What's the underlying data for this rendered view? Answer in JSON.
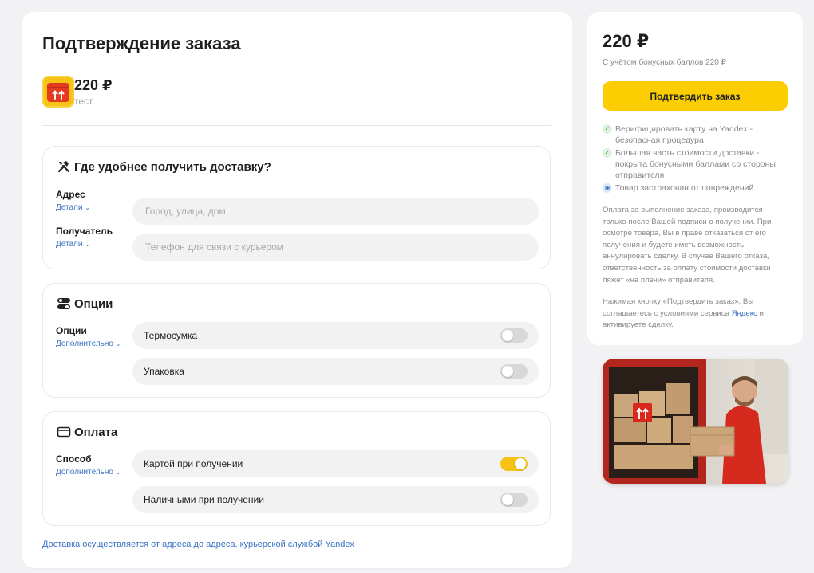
{
  "order": {
    "title": "Подтверждение заказа",
    "product_price": "220 ₽",
    "product_name": "тест"
  },
  "delivery": {
    "heading": "Где удобнее получить доставку?",
    "address_label": "Адрес",
    "address_details": "Детали",
    "address_placeholder": "Город, улица, дом",
    "recipient_label": "Получатель",
    "recipient_details": "Детали",
    "recipient_placeholder": "Телефон для связи с курьером"
  },
  "options": {
    "heading": "Опции",
    "label": "Опции",
    "more": "Дополнительно",
    "items": [
      {
        "label": "Термосумка",
        "on": false
      },
      {
        "label": "Упаковка",
        "on": false
      }
    ]
  },
  "payment": {
    "heading": "Оплата",
    "label": "Способ",
    "more": "Дополнительно",
    "items": [
      {
        "label": "Картой при получении",
        "on": true
      },
      {
        "label": "Наличными при получении",
        "on": false
      }
    ]
  },
  "footer_link": "Доставка осуществляется от адреса до адреса, курьерской службой Yandex",
  "summary": {
    "price": "220 ₽",
    "bonus_note": "С учётом бонусных баллов 220 ₽",
    "confirm_label": "Подтвердить заказ",
    "bullets": [
      {
        "icon": "check-icon",
        "text": "Верифицировать карту на Yandex - безопасная процедура"
      },
      {
        "icon": "check-icon",
        "text": "Большая часть стоимости доставки - покрыта бонусными баллами со стороны отправителя"
      },
      {
        "icon": "shield-icon",
        "text": "Товар застрахован от повреждений"
      }
    ],
    "payment_note": "Оплата за выполнение заказа, производится только после Вашей подписи о получении. При осмотре товара, Вы в праве отказаться от его получения и будете иметь возможность аннулировать сделку. В случае Вашего отказа, ответственность за оплату стоимости доставки ляжет «на плечи» отправителя.",
    "terms_before": "Нажимая кнопку «Подтвердить заказ», Вы соглашаетесь с условиями сервиса ",
    "terms_brand": "Яндекс",
    "terms_after": " и активируете сделку."
  },
  "colors": {
    "accent_yellow": "#fccd00",
    "toggle_on": "#f6c315",
    "link_blue": "#3b73c4"
  }
}
